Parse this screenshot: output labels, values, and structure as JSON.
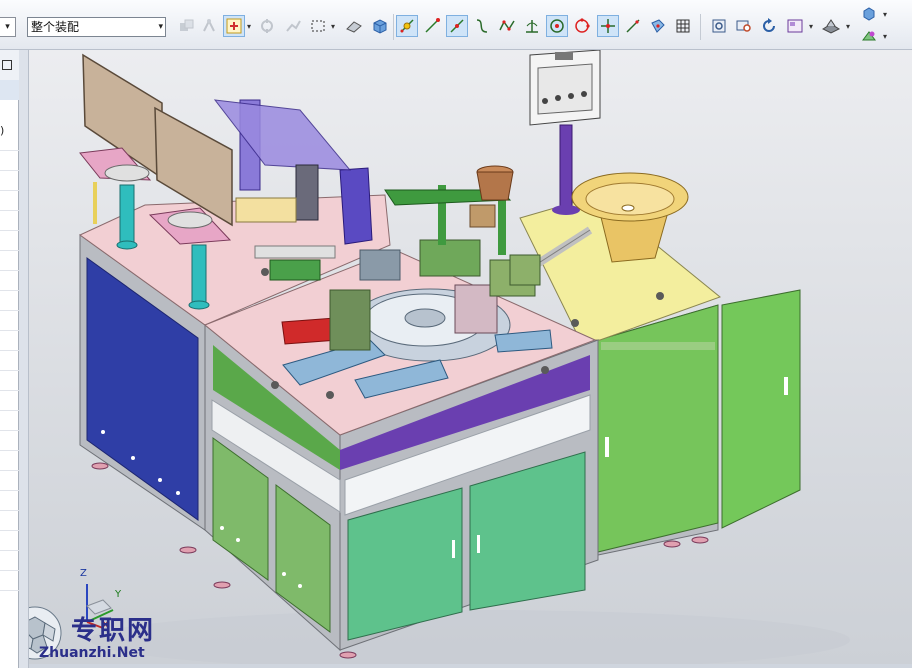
{
  "toolbar": {
    "assembly_filter": {
      "value": "整个装配"
    },
    "tools": [
      {
        "name": "move-component"
      },
      {
        "name": "reposition"
      },
      {
        "name": "constraint-select"
      },
      {
        "name": "constraint-node"
      },
      {
        "name": "rectangle-select"
      },
      {
        "name": "eraser"
      },
      {
        "name": "solid-body"
      },
      {
        "name": "snap-point"
      },
      {
        "name": "line-end"
      },
      {
        "name": "curve-on"
      },
      {
        "name": "spline"
      },
      {
        "name": "polyline"
      },
      {
        "name": "perpendicular"
      },
      {
        "name": "center-point"
      },
      {
        "name": "circle-point"
      },
      {
        "name": "intersection"
      },
      {
        "name": "tangent"
      },
      {
        "name": "face-point"
      },
      {
        "name": "grid"
      },
      {
        "name": "fit-view"
      },
      {
        "name": "zoom-window"
      },
      {
        "name": "rotate"
      },
      {
        "name": "display-dropdown"
      },
      {
        "name": "render-style"
      },
      {
        "name": "view-cube"
      },
      {
        "name": "orient-view"
      }
    ]
  },
  "left_panel": {
    "paren": ")"
  },
  "viewport": {
    "axis": {
      "z": "Z",
      "y": "Y",
      "x": "X"
    }
  },
  "watermark": {
    "title": "专职网",
    "url": "Zhuanzhi.Net"
  },
  "colors": {
    "cabinet_blue": "#2f3ea6",
    "door_green": "#74c85a",
    "tabletop_pink": "#f2cfd3",
    "tabletop_yellow": "#f3ee9e",
    "frame_gray": "#b9bcc2",
    "monitor_tan": "#c8b29a",
    "column_cyan": "#2fbdbd",
    "column_purple": "#6a3fb0",
    "bowl_yellow": "#e9c465"
  }
}
